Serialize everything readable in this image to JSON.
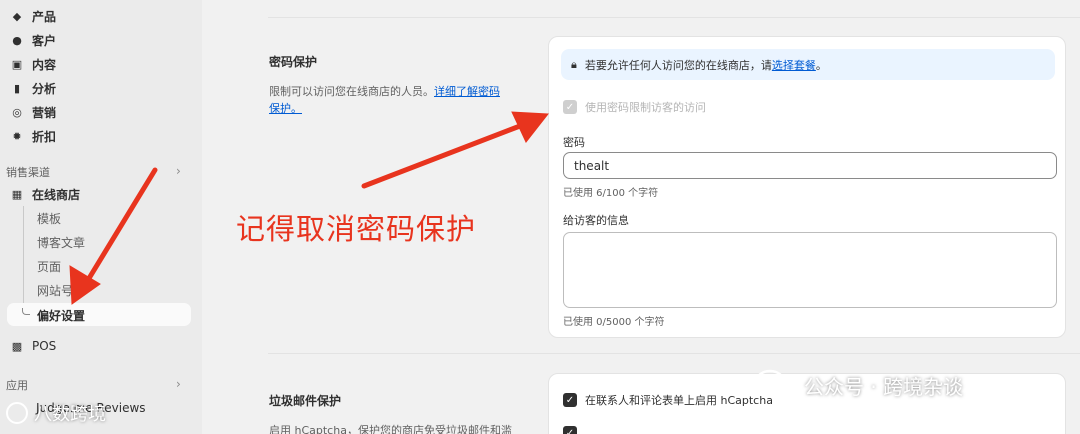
{
  "sidebar": {
    "items": [
      {
        "label": "产品",
        "icon": "tag-icon"
      },
      {
        "label": "客户",
        "icon": "person-icon"
      },
      {
        "label": "内容",
        "icon": "image-icon"
      },
      {
        "label": "分析",
        "icon": "bar-chart-icon"
      },
      {
        "label": "营销",
        "icon": "target-icon"
      },
      {
        "label": "折扣",
        "icon": "discount-icon"
      }
    ],
    "sales_channels_label": "销售渠道",
    "online_store_label": "在线商店",
    "online_store_sub": [
      "模板",
      "博客文章",
      "页面",
      "网站号"
    ],
    "active_sub": "偏好设置",
    "pos_label": "POS",
    "apps_label": "应用",
    "app_item": "Judge.me Reviews"
  },
  "password_section": {
    "title": "密码保护",
    "desc_text": "限制可以访问您在线商店的人员。",
    "desc_link": "详细了解密码保护。",
    "banner_text": "若要允许任何人访问您的在线商店，请",
    "banner_link": "选择套餐",
    "banner_end": "。",
    "checkbox_label": "使用密码限制访客的访问",
    "password_label": "密码",
    "password_value": "thealt",
    "password_help": "已使用 6/100 个字符",
    "message_label": "给访客的信息",
    "message_help": "已使用 0/5000 个字符"
  },
  "spam_section": {
    "title": "垃圾邮件保护",
    "desc_text": "启用 hCaptcha，保护您的商店免受垃圾邮件和滥",
    "checkbox_label": "在联系人和评论表单上启用 hCaptcha"
  },
  "annotation": {
    "text": "记得取消密码保护",
    "color": "#e8341e"
  },
  "watermarks": {
    "wechat": "公众号 · 跨境杂谈",
    "brand": "八数跨境"
  }
}
